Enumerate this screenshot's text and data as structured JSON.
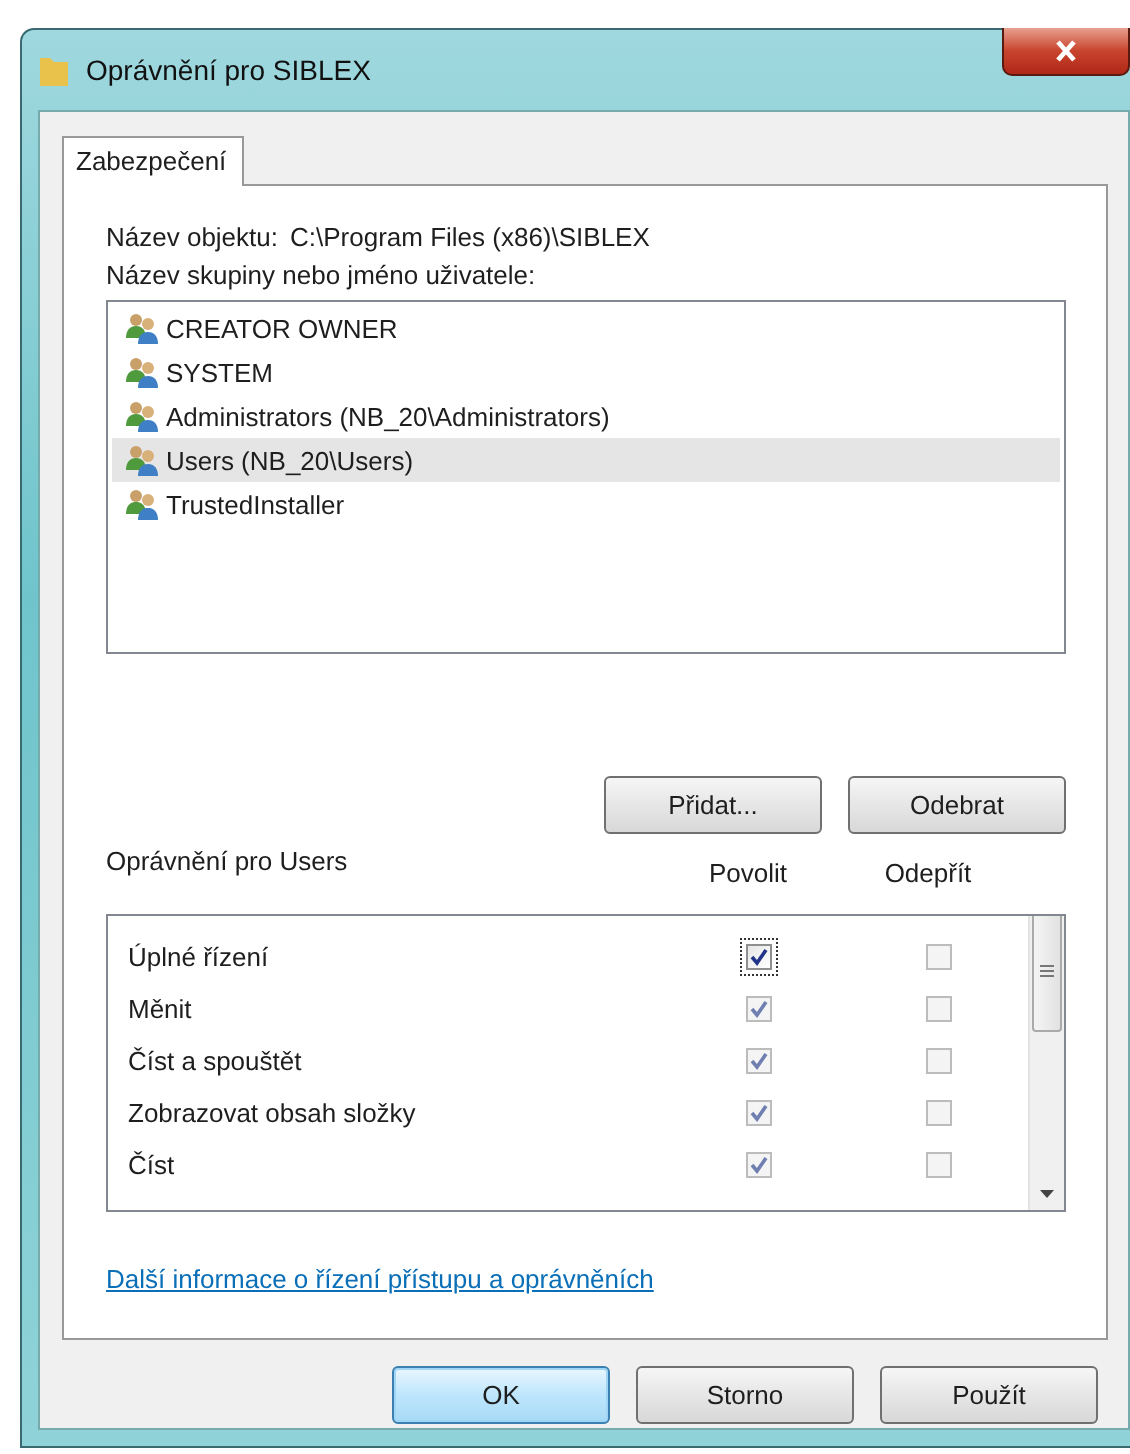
{
  "window": {
    "title": "Oprávnění pro SIBLEX"
  },
  "tabs": [
    {
      "label": "Zabezpečení",
      "selected": true
    }
  ],
  "object_name": {
    "label": "Název objektu:",
    "value": "C:\\Program Files (x86)\\SIBLEX"
  },
  "principals": {
    "label": "Název skupiny nebo jméno uživatele:",
    "items": [
      {
        "name": "CREATOR OWNER",
        "selected": false
      },
      {
        "name": "SYSTEM",
        "selected": false
      },
      {
        "name": "Administrators (NB_20\\Administrators)",
        "selected": false
      },
      {
        "name": "Users (NB_20\\Users)",
        "selected": true
      },
      {
        "name": "TrustedInstaller",
        "selected": false
      }
    ]
  },
  "principal_buttons": [
    "Přidat...",
    "Odebrat"
  ],
  "permissions": {
    "label": "Oprávnění pro Users",
    "columns": [
      "Povolit",
      "Odepřít"
    ],
    "rows": [
      {
        "name": "Úplné řízení",
        "allow": {
          "checked": true,
          "disabled": false
        },
        "deny": {
          "checked": false,
          "disabled": true
        }
      },
      {
        "name": "Měnit",
        "allow": {
          "checked": true,
          "disabled": true
        },
        "deny": {
          "checked": false,
          "disabled": true
        }
      },
      {
        "name": "Číst a spouštět",
        "allow": {
          "checked": true,
          "disabled": true
        },
        "deny": {
          "checked": false,
          "disabled": true
        }
      },
      {
        "name": "Zobrazovat obsah složky",
        "allow": {
          "checked": true,
          "disabled": true
        },
        "deny": {
          "checked": false,
          "disabled": true
        }
      },
      {
        "name": "Číst",
        "allow": {
          "checked": true,
          "disabled": true
        },
        "deny": {
          "checked": false,
          "disabled": true
        }
      }
    ]
  },
  "help_link": "Další informace o řízení přístupu a oprávněních",
  "buttons": [
    {
      "label": "OK",
      "default": true
    },
    {
      "label": "Storno",
      "default": false
    },
    {
      "label": "Použít",
      "default": false
    }
  ]
}
